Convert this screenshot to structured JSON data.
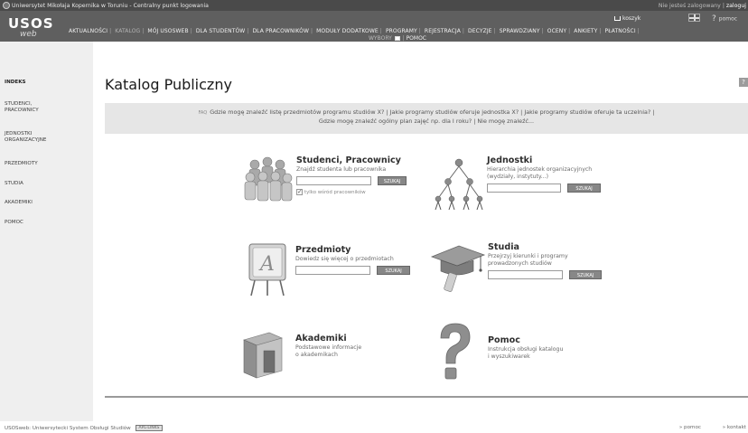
{
  "topbar": {
    "title": "Uniwersytet Mikołaja Kopernika w Toruniu - Centralny punkt logowania",
    "login_status": "Nie jesteś zalogowany |",
    "login_link": "zaloguj"
  },
  "header": {
    "brand": "USOS",
    "brand_sub": "web",
    "cart": "koszyk",
    "help": "pomoc",
    "menu": [
      "AKTUALNOŚCI",
      "KATALOG",
      "MÓJ USOSWEB",
      "DLA STUDENTÓW",
      "DLA PRACOWNIKÓW",
      "MODUŁY DODATKOWE",
      "PROGRAMY",
      "REJESTRACJA",
      "DECYZJE",
      "SPRAWDZIANY",
      "OCENY",
      "ANKIETY",
      "PŁATNOŚCI"
    ],
    "menu2": [
      "WYBORY",
      "POMOC"
    ],
    "active_menu": "KATALOG"
  },
  "sidebar": {
    "items": [
      {
        "label": "INDEKS"
      },
      {
        "label": "STUDENCI, PRACOWNICY"
      },
      {
        "label": "JEDNOSTKI ORGANIZACYJNE"
      },
      {
        "label": "PRZEDMIOTY"
      },
      {
        "label": "STUDIA"
      },
      {
        "label": "AKADEMIKI"
      },
      {
        "label": "POMOC"
      }
    ]
  },
  "main": {
    "title": "Katalog Publiczny",
    "title_icon": "?",
    "faq_label": "FAQ",
    "faq_line1": "Gdzie mogę znaleźć listę przedmiotów programu studiów X? | Jakie programy studiów oferuje jednostka X? | Jakie programy studiów oferuje ta uczelnia? |",
    "faq_line2": "Gdzie mogę znaleźć ogólny plan zajęć np. dla I roku? | Nie mogę znaleźć..."
  },
  "tiles": {
    "studenci": {
      "title": "Studenci, Pracownicy",
      "desc": "Znajdź studenta lub pracownika",
      "button": "SZUKAJ",
      "checkbox": "tylko wśród pracowników"
    },
    "jednostki": {
      "title": "Jednostki",
      "desc1": "Hierarchia jednostek organizacyjnych",
      "desc2": "(wydziały, instytuty...)",
      "button": "SZUKAJ"
    },
    "przedmioty": {
      "title": "Przedmioty",
      "desc": "Dowiedz się więcej o przedmiotach",
      "button": "SZUKAJ"
    },
    "studia": {
      "title": "Studia",
      "desc1": "Przejrzyj kierunki i programy",
      "desc2": "prowadzonych studiów",
      "button": "SZUKAJ"
    },
    "akademiki": {
      "title": "Akademiki",
      "desc1": "Podstawowe informacje",
      "desc2": "o akademikach"
    },
    "pomoc": {
      "title": "Pomoc",
      "desc1": "Instrukcja obsługi katalogu",
      "desc2": "i wyszukiwarek"
    }
  },
  "footer": {
    "left": "USOSweb: Uniwersytecki System Obsługi Studiów",
    "badge": "APL-LINKS",
    "link_help": "» pomoc",
    "link_contact": "» kontakt"
  }
}
